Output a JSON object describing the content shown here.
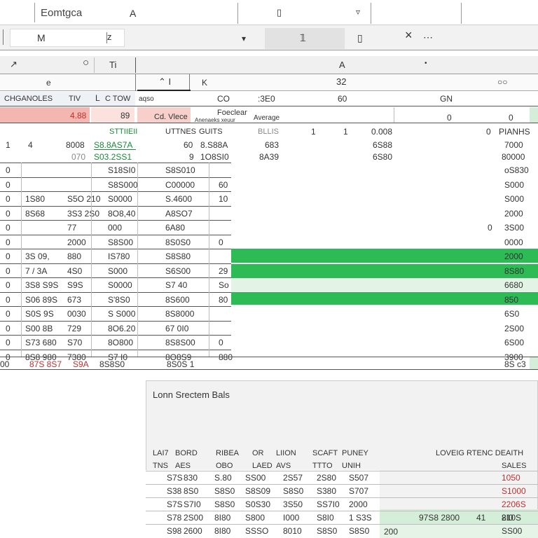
{
  "toolbar1": {
    "font_name": "Eomtgca",
    "font_letter": "A",
    "box_icon_label": "▯",
    "dropdown_glyph": "▿"
  },
  "toolbar2": {
    "m_label": "M",
    "z_label": "z",
    "dropdown_glyph": "▾",
    "slot_icon": "𝟙",
    "copy_icon": "▯",
    "close_icon": "×",
    "more_icon": "⋯"
  },
  "formula": {
    "tool_glyph": "↗",
    "circle_glyph": "○",
    "cell_label": "Ti",
    "column_a": "A",
    "dot": "•"
  },
  "colheaders": {
    "e": "e",
    "caret": "⌃ I",
    "k": "K",
    "num": "32",
    "search": "○○"
  },
  "row1": {
    "a": "CHGANOLES",
    "b": "TIV",
    "c": "L",
    "d": "C TOW",
    "e": "aqso",
    "f": "CO",
    "g": ":3E0",
    "h": "60",
    "i": "GN"
  },
  "row2": {
    "a": "4.88",
    "b": "89",
    "c": "Cd. Vlece",
    "d": "Foeclear",
    "e": "Anenaeks xeuur",
    "f": "Average",
    "g": "0",
    "h": "0"
  },
  "row3": {
    "a": "STTIIEII",
    "b": "UTTNES",
    "c": "GUITS",
    "d": "BLLIS",
    "e": "1",
    "f": "1",
    "g": "0.008",
    "h": "0",
    "i": "PIANHS"
  },
  "row4": {
    "a": "1",
    "b": "4",
    "c": "8008",
    "d": "S8.8AS7A",
    "e": "60",
    "f": "8.S88A",
    "g": "683",
    "h": "6S88",
    "i": "7000"
  },
  "row5": {
    "c": "070",
    "d": "S03.2SS1",
    "e": "9",
    "f": "1O8SI0",
    "g": "8A39",
    "h": "6S80",
    "i": "80000"
  },
  "grid_rows": [
    {
      "a": "0",
      "b": "",
      "c": "",
      "d": "S18SI0",
      "e": "S8S010",
      "f": "",
      "i": "oS830"
    },
    {
      "a": "0",
      "b": "",
      "c": "",
      "d": "S8S000",
      "e": "C00000",
      "f": "60",
      "i": "S000"
    },
    {
      "a": "0",
      "b": "1S80",
      "c": "S5O 210",
      "d": "S0000",
      "e": "S.4600",
      "f": "10",
      "i": "S000"
    },
    {
      "a": "0",
      "b": "8S68",
      "c": "3S3 2S0",
      "d": "8O8,40",
      "e": "A8SO7",
      "f": "",
      "i": "2000"
    },
    {
      "a": "0",
      "b": "",
      "c": "77",
      "d": "000",
      "e": "6A80",
      "f": "",
      "g": "0",
      "i": "3S00"
    },
    {
      "a": "0",
      "b": "",
      "c": "2000",
      "d": "S8S00",
      "e": "8S0S0",
      "f": "0",
      "i": "0000"
    },
    {
      "a": "0",
      "b": "3S 09,",
      "c": "880",
      "d": "IS780",
      "e": "S8S80",
      "f": "",
      "i": "2000"
    },
    {
      "a": "0",
      "b": "7 / 3A",
      "c": "4S0",
      "d": "S000",
      "e": "S6S00",
      "f": "29",
      "i": "8S80"
    },
    {
      "a": "0",
      "b": "3S8 S9S",
      "c": "S9S",
      "d": "S0000",
      "e": "S7 40",
      "f": "So",
      "i": "6680"
    },
    {
      "a": "0",
      "b": "S06 89S",
      "c": "673",
      "d": "S'8S0",
      "e": "8S600",
      "f": "80",
      "i": "850"
    },
    {
      "a": "0",
      "b": "S0S 9S",
      "c": "0030",
      "d": "S S000",
      "e": "8S8000",
      "f": "",
      "i": "6S0"
    },
    {
      "a": "0",
      "b": "S00 8B",
      "c": "729",
      "d": "8O6.20",
      "e": "67 0I0",
      "f": "",
      "i": "2S00"
    },
    {
      "a": "0",
      "b": "S73 680",
      "c": "S70",
      "d": "8O800",
      "e": "8S8S00",
      "f": "0",
      "i": "6S00"
    },
    {
      "a": "0",
      "b": "8S8 980",
      "c": "7380",
      "d": "S7 I0",
      "e": "8O8S9",
      "f": "880",
      "i": "3900"
    }
  ],
  "total_row": {
    "a": "00",
    "b": "87S 8S7",
    "c": "S9A",
    "d": "8S8S0",
    "e": "8S0S 1",
    "i": "8S c3"
  },
  "summary": {
    "title": "Lonn Srectem Bals",
    "headers_top": [
      "LAI7",
      "BORD",
      "RIBEA",
      "OR",
      "LIION",
      "SCAFT",
      "PUNEY"
    ],
    "headers_sub": [
      "TNS",
      "AES",
      "OBO",
      "LAED",
      "AVS",
      "TTTO",
      "UNIH"
    ],
    "right_header": "LOVEIG RTENC DEAITH",
    "right_sub": "SALES",
    "rows": [
      [
        "S7S",
        "830",
        "S.80",
        "SS00",
        "2S57",
        "2S80",
        "S507",
        "1050"
      ],
      [
        "S38",
        "8S0",
        "S8S0",
        "S8S09",
        "S8S0",
        "S380",
        "S707",
        "S1000"
      ],
      [
        "S7S",
        "S7I0",
        "S8S0",
        "S0S30",
        "3S50",
        "SS7I0",
        "2000",
        "2206S"
      ],
      [
        "S78",
        "2S00",
        "8I80",
        "S800",
        "I000",
        "S8I0",
        "1 S3S",
        "8I0"
      ],
      [
        "S98",
        "2600",
        "8I80",
        "SSSO",
        "8010",
        "S8S0",
        "S8S0",
        "SS00"
      ]
    ],
    "green_row_extra": [
      "97S8 2800",
      "41",
      "210S"
    ],
    "last_row_extra": "200"
  },
  "colors": {
    "green_bar": "#2dbb55",
    "green_light": "#d4eed9",
    "red_cell": "#f4b6b0",
    "accent_red": "#c03030"
  }
}
